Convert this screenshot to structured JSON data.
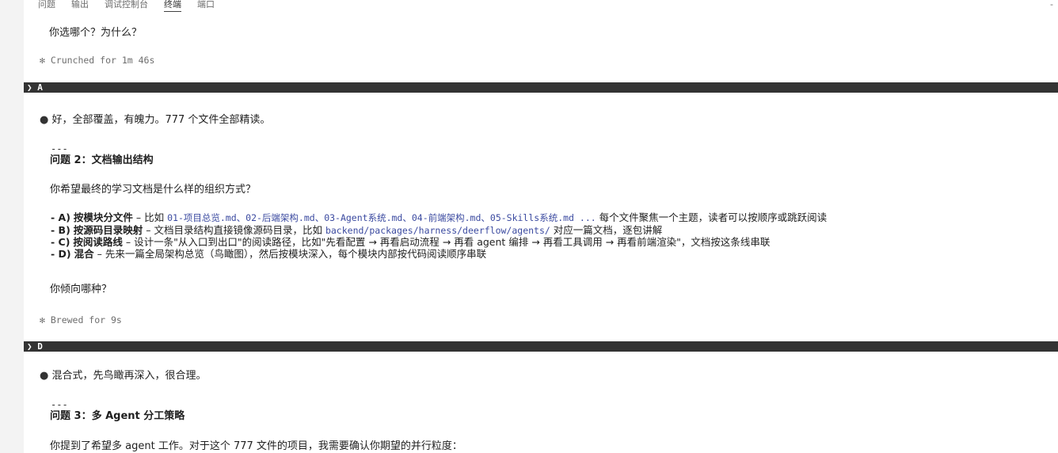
{
  "panel": {
    "tabs": [
      "问题",
      "输出",
      "调试控制台",
      "终端",
      "端口"
    ],
    "active_tab": "终端",
    "more": "-"
  },
  "terminal": {
    "question_1_tail": "你选哪个？为什么？",
    "status_1": "✻ Crunched for 1m 46s",
    "reply_1_prompt": "❯",
    "reply_1": "A",
    "assistant_1": "好，全部覆盖，有魄力。777 个文件全部精读。",
    "sep_1": "---",
    "heading_2": "问题 2：文档输出结构",
    "ask_2": "你希望最终的学习文档是什么样的组织方式？",
    "options_2": [
      {
        "key": "- A)",
        "title": "按模块分文件",
        "dash": " – 比如 ",
        "code": "01-项目总览.md、02-后端架构.md、03-Agent系统.md、04-前端架构.md、05-Skills系统.md ...",
        "rest": " 每个文件聚焦一个主题，读者可以按顺序或跳跃阅读"
      },
      {
        "key": "- B)",
        "title": "按源码目录映射",
        "dash": " – 文档目录结构直接镜像源码目录，比如 ",
        "code": "backend/packages/harness/deerflow/agents/",
        "rest": " 对应一篇文档，逐包讲解"
      },
      {
        "key": "- C)",
        "title": "按阅读路线",
        "dash": " – 设计一条\"从入口到出口\"的阅读路径，比如\"先看配置 → 再看启动流程 → 再看 agent 编排 → 再看工具调用 → 再看前端渲染\"，文档按这条线串联",
        "code": "",
        "rest": ""
      },
      {
        "key": "- D)",
        "title": "混合",
        "dash": " – 先来一篇全局架构总览（鸟瞰图），然后按模块深入，每个模块内部按代码阅读顺序串联",
        "code": "",
        "rest": ""
      }
    ],
    "ask_2b": "你倾向哪种？",
    "status_2": "✻ Brewed for 9s",
    "reply_2_prompt": "❯",
    "reply_2": "D",
    "assistant_2": "混合式，先鸟瞰再深入，很合理。",
    "sep_2": "---",
    "heading_3": "问题 3：多 Agent 分工策略",
    "ask_3": "你提到了希望多 agent 工作。对于这个 777 文件的项目，我需要确认你期望的并行粒度："
  },
  "colors": {
    "bar_bg": "#333333",
    "code": "#3b4aa0",
    "status": "#6e6e6e"
  }
}
